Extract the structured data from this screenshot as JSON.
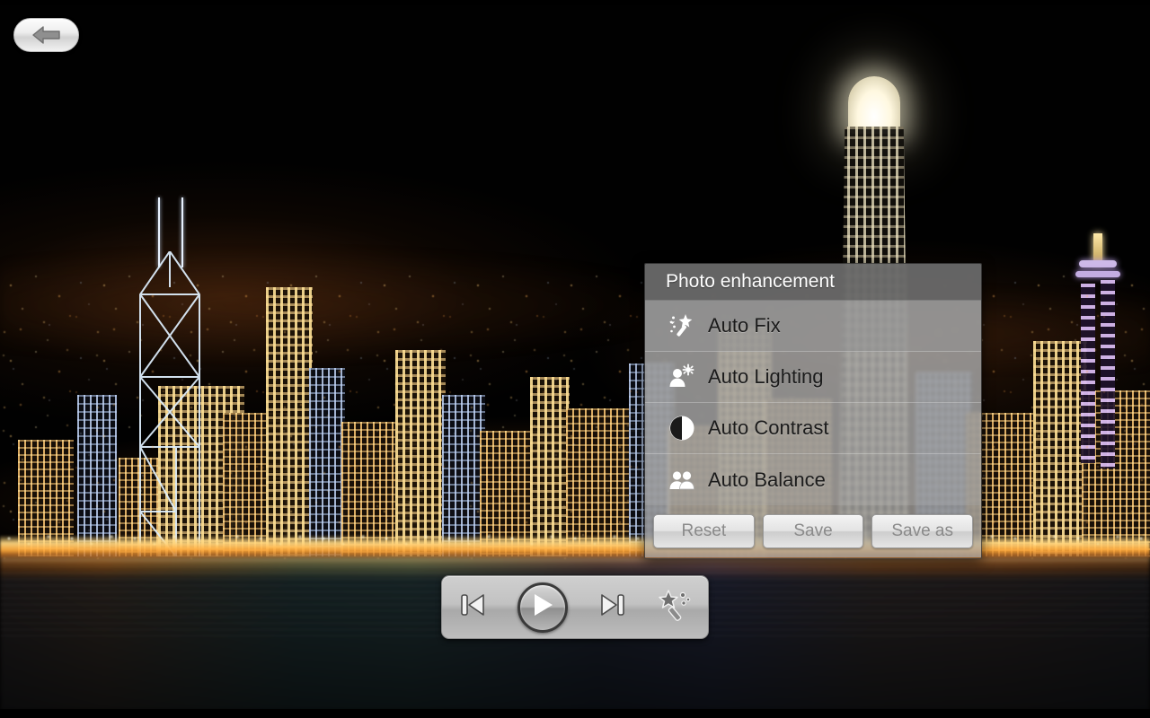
{
  "app": {
    "screen_name": "Photo viewer",
    "background_photo": "hong-kong-harbour-night-skyline"
  },
  "back_button": {
    "name": "back-button",
    "icon": "back-arrow-icon"
  },
  "dialog": {
    "title": "Photo enhancement",
    "items": [
      {
        "label": "Auto Fix",
        "icon": "magic-wand-icon",
        "selected": true
      },
      {
        "label": "Auto Lighting",
        "icon": "person-sun-icon",
        "selected": false
      },
      {
        "label": "Auto Contrast",
        "icon": "half-circle-icon",
        "selected": false
      },
      {
        "label": "Auto Balance",
        "icon": "two-people-icon",
        "selected": false
      }
    ],
    "buttons": [
      {
        "label": "Reset",
        "name": "reset-button"
      },
      {
        "label": "Save",
        "name": "save-button"
      },
      {
        "label": "Save as",
        "name": "save-as-button"
      }
    ]
  },
  "controls": {
    "previous": {
      "label": "Previous",
      "icon": "skip-previous-icon"
    },
    "play": {
      "label": "Play",
      "icon": "play-icon"
    },
    "next": {
      "label": "Next",
      "icon": "skip-next-icon"
    },
    "enhance": {
      "label": "Enhance",
      "icon": "magic-wand-icon"
    }
  },
  "colors": {
    "dialog_title_bg": "#6c6c6c",
    "dialog_body_bg": "#acacac",
    "dialog_title_text": "#ffffff",
    "menu_label_text": "#1b1b1b",
    "button_text": "#8a8a8a",
    "control_bar_bg": "#bdbdbd"
  }
}
